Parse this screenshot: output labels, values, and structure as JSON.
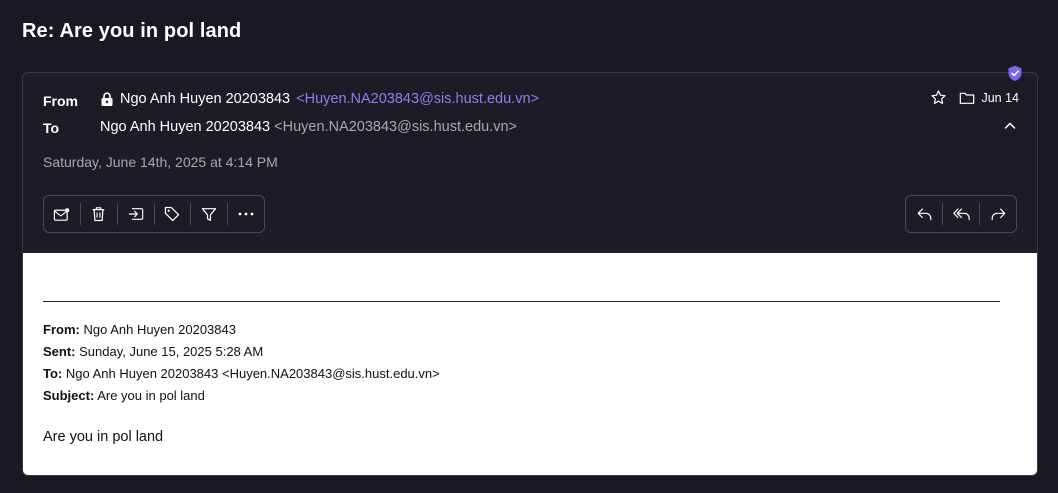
{
  "message": {
    "subject": "Re: Are you in pol land",
    "from_label": "From",
    "to_label": "To",
    "from_name": "Ngo Anh Huyen 20203843",
    "from_address": "<Huyen.NA203843@sis.hust.edu.vn>",
    "to_name": "Ngo Anh Huyen 20203843",
    "to_address": "<Huyen.NA203843@sis.hust.edu.vn>",
    "date": "Saturday, June 14th, 2025 at 4:14 PM",
    "short_date": "Jun 14"
  },
  "icons": {
    "verified": "shield-check-icon",
    "lock": "lock-icon",
    "star": "star-icon",
    "folder": "folder-icon",
    "collapse": "chevron-up-icon"
  },
  "toolbar_left": [
    "mark-unread-icon",
    "trash-icon",
    "move-to-folder-icon",
    "label-tag-icon",
    "filter-icon",
    "more-icon"
  ],
  "toolbar_right": [
    "reply-icon",
    "reply-all-icon",
    "forward-icon"
  ],
  "quoted": {
    "from_key": "From:",
    "from_val": " Ngo Anh Huyen 20203843",
    "sent_key": "Sent:",
    "sent_val": " Sunday, June 15, 2025 5:28 AM",
    "to_key": "To:",
    "to_val": " Ngo Anh Huyen 20203843 <Huyen.NA203843@sis.hust.edu.vn>",
    "subject_key": "Subject:",
    "subject_val": " Are you in pol land"
  },
  "body_text": "Are you in pol land",
  "colors": {
    "background": "#191823",
    "accent": "#8f7df5",
    "muted": "#a9a7b6"
  }
}
